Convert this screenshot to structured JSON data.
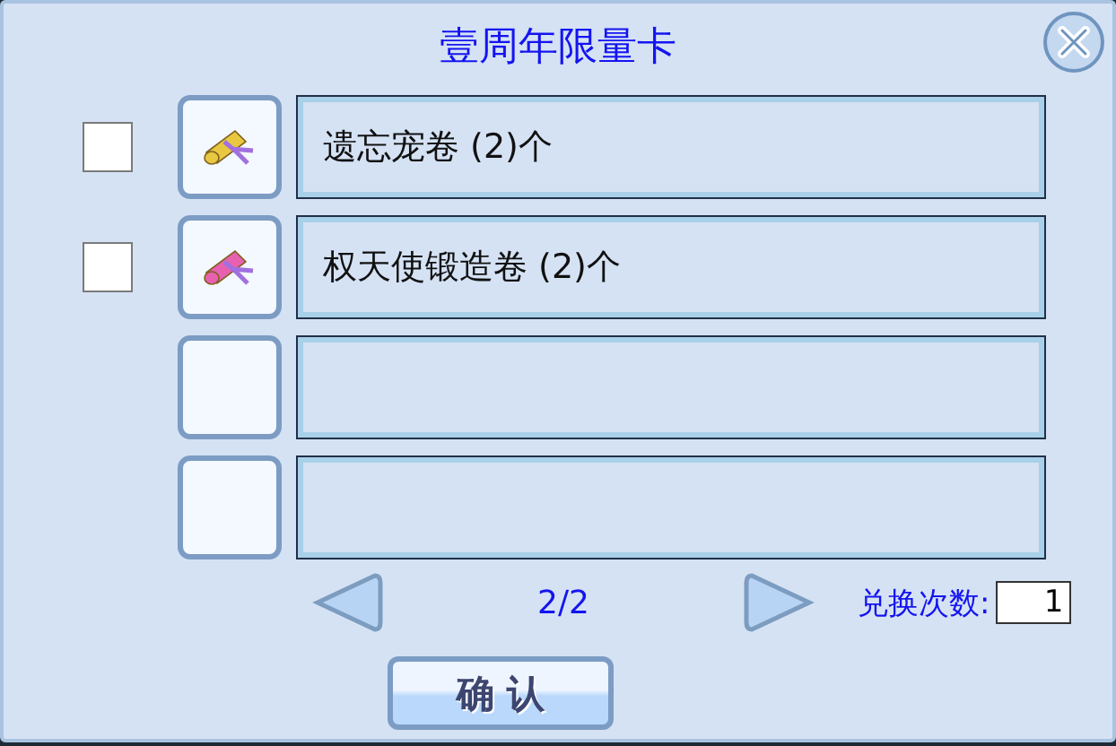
{
  "window": {
    "title": "壹周年限量卡"
  },
  "items": [
    {
      "kind": "scroll",
      "name": "遗忘宠卷 (2)个",
      "checked": false,
      "color": "#e8c840"
    },
    {
      "kind": "scroll",
      "name": "权天使锻造卷 (2)个",
      "checked": false,
      "color": "#e860b0"
    },
    {
      "kind": "empty"
    },
    {
      "kind": "empty"
    }
  ],
  "pager": {
    "page": "2/2"
  },
  "exchange": {
    "label": "兑换次数:",
    "value": "1"
  },
  "buttons": [
    "确 认"
  ]
}
